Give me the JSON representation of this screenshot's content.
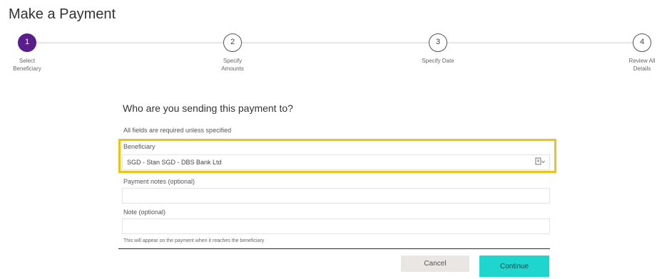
{
  "page": {
    "title": "Make a Payment"
  },
  "stepper": {
    "steps": [
      {
        "number": "1",
        "label": "Select\nBeneficiary",
        "active": true
      },
      {
        "number": "2",
        "label": "Specify\nAmounts",
        "active": false
      },
      {
        "number": "3",
        "label": "Specify Date",
        "active": false
      },
      {
        "number": "4",
        "label": "Review All\nDetails",
        "active": false
      }
    ]
  },
  "form": {
    "title": "Who are you sending this payment to?",
    "hint": "All fields are required unless specified",
    "beneficiary": {
      "label": "Beneficiary",
      "value": "SGD - Stan SGD - DBS Bank Ltd",
      "icon": "contact-select-icon"
    },
    "payment_notes": {
      "label": "Payment notes (optional)",
      "value": ""
    },
    "note": {
      "label": "Note (optional)",
      "value": "",
      "help": "This will appear on the payment when it reaches the beneficiary"
    }
  },
  "actions": {
    "cancel_label": "Cancel",
    "continue_label": "Continue"
  },
  "colors": {
    "active_step": "#5a1d8c",
    "highlight": "#f2c111",
    "continue_button": "#1fd6cf",
    "cancel_button": "#e9e6e3"
  }
}
